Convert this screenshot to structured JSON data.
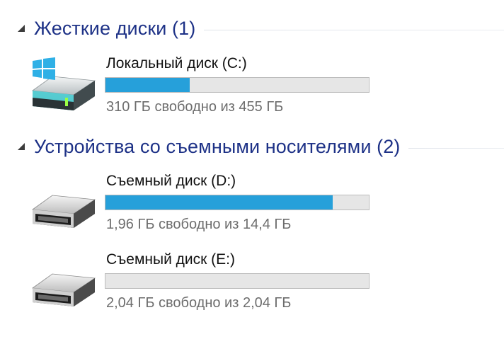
{
  "groups": [
    {
      "title": "Жесткие диски (1)",
      "drives": [
        {
          "name": "Локальный диск (C:)",
          "icon": "system-drive-icon",
          "used_fraction": 0.319,
          "info": "310 ГБ свободно из 455 ГБ"
        }
      ]
    },
    {
      "title": "Устройства со съемными носителями (2)",
      "drives": [
        {
          "name": "Съемный диск (D:)",
          "icon": "removable-drive-icon",
          "used_fraction": 0.864,
          "info": "1,96 ГБ свободно из 14,4 ГБ"
        },
        {
          "name": "Съемный диск (E:)",
          "icon": "removable-drive-icon",
          "used_fraction": 0,
          "info": "2,04 ГБ свободно из 2,04 ГБ"
        }
      ]
    }
  ],
  "colors": {
    "group_title": "#1e3287",
    "bar_fill": "#26a0da",
    "bar_track": "#e6e6e6",
    "info_text": "#6d6d6d"
  }
}
